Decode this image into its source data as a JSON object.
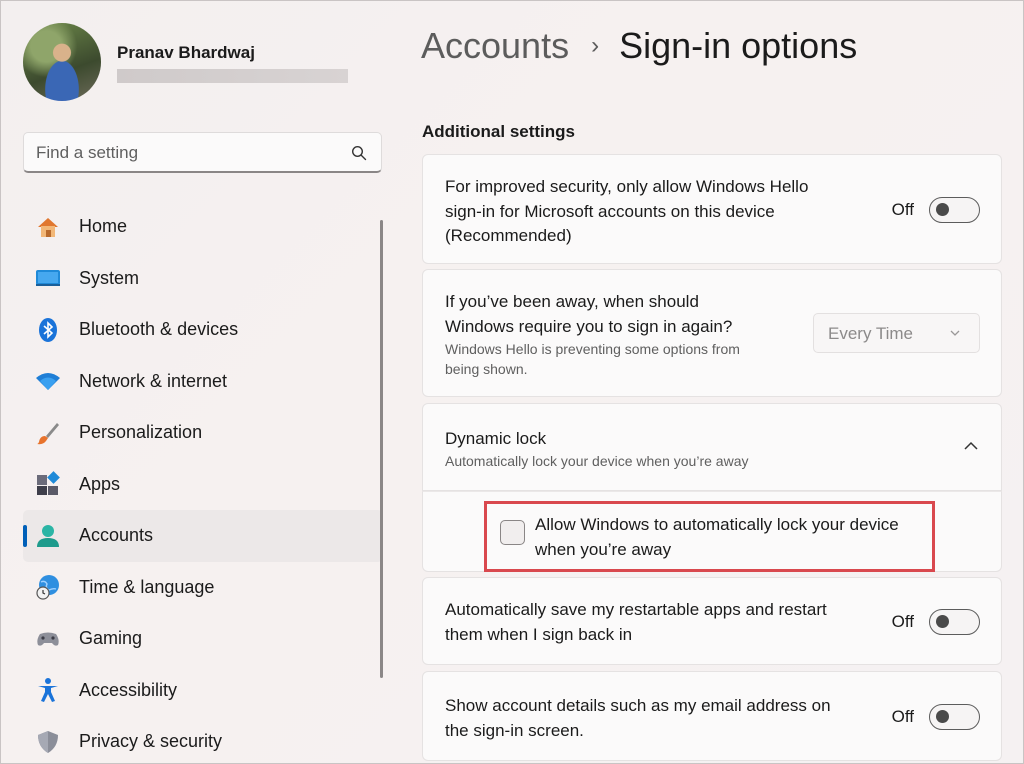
{
  "user": {
    "name": "Pranav Bhardwaj"
  },
  "search": {
    "placeholder": "Find a setting"
  },
  "sidebar": {
    "items": [
      {
        "label": "Home",
        "icon": "home-icon"
      },
      {
        "label": "System",
        "icon": "system-icon"
      },
      {
        "label": "Bluetooth & devices",
        "icon": "bluetooth-icon"
      },
      {
        "label": "Network & internet",
        "icon": "wifi-icon"
      },
      {
        "label": "Personalization",
        "icon": "brush-icon"
      },
      {
        "label": "Apps",
        "icon": "apps-icon"
      },
      {
        "label": "Accounts",
        "icon": "accounts-icon",
        "active": true
      },
      {
        "label": "Time & language",
        "icon": "globe-clock-icon"
      },
      {
        "label": "Gaming",
        "icon": "gamepad-icon"
      },
      {
        "label": "Accessibility",
        "icon": "accessibility-icon"
      },
      {
        "label": "Privacy & security",
        "icon": "shield-icon"
      }
    ]
  },
  "breadcrumb": {
    "parent": "Accounts",
    "separator": "›",
    "current": "Sign-in options"
  },
  "section": {
    "title": "Additional settings"
  },
  "cards": {
    "hello_only": {
      "text_line1": "For improved security, only allow Windows Hello",
      "text_line2": "sign-in for Microsoft accounts on this device",
      "text_line3": "(Recommended)",
      "toggle_label": "Off",
      "toggle_on": false
    },
    "away_signin": {
      "text_line1": "If you’ve been away, when should",
      "text_line2": "Windows require you to sign in again?",
      "sub_line1": "Windows Hello is preventing some options from",
      "sub_line2": "being shown.",
      "dropdown_value": "Every Time"
    },
    "dynamic_lock": {
      "title": "Dynamic lock",
      "subtitle": "Automatically lock your device when you’re away",
      "expanded": true,
      "checkbox_line1": "Allow Windows to automatically lock your device",
      "checkbox_line2": "when you’re away",
      "checkbox_checked": false
    },
    "restart_apps": {
      "text_line1": "Automatically save my restartable apps and restart",
      "text_line2": "them when I sign back in",
      "toggle_label": "Off",
      "toggle_on": false
    },
    "account_details": {
      "text_line1": "Show account details such as my email address on",
      "text_line2": "the sign-in screen.",
      "toggle_label": "Off",
      "toggle_on": false
    }
  },
  "colors": {
    "accent": "#005fb8",
    "highlight": "#d9484e"
  }
}
